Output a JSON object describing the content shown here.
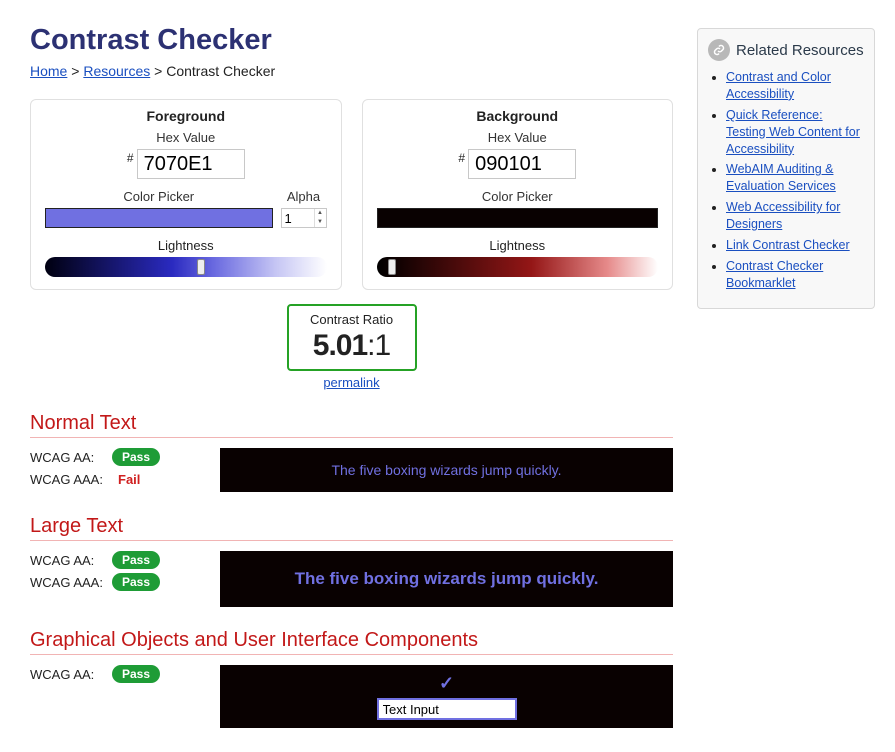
{
  "title": "Contrast Checker",
  "breadcrumbs": {
    "home": "Home",
    "resources": "Resources",
    "current": "Contrast Checker"
  },
  "foreground": {
    "heading": "Foreground",
    "hex_label": "Hex Value",
    "hex_value": "7070E1",
    "picker_label": "Color Picker",
    "alpha_label": "Alpha",
    "alpha_value": "1",
    "lightness_label": "Lightness",
    "swatch_color": "#7070E1"
  },
  "background": {
    "heading": "Background",
    "hex_label": "Hex Value",
    "hex_value": "090101",
    "picker_label": "Color Picker",
    "lightness_label": "Lightness",
    "swatch_color": "#090101"
  },
  "ratio": {
    "label": "Contrast Ratio",
    "value": "5.01",
    "suffix": ":1",
    "permalink": "permalink"
  },
  "normal_text": {
    "heading": "Normal Text",
    "aa_label": "WCAG AA:",
    "aa_result": "Pass",
    "aaa_label": "WCAG AAA:",
    "aaa_result": "Fail",
    "sample": "The five boxing wizards jump quickly."
  },
  "large_text": {
    "heading": "Large Text",
    "aa_label": "WCAG AA:",
    "aa_result": "Pass",
    "aaa_label": "WCAG AAA:",
    "aaa_result": "Pass",
    "sample": "The five boxing wizards jump quickly."
  },
  "gui": {
    "heading": "Graphical Objects and User Interface Components",
    "aa_label": "WCAG AA:",
    "aa_result": "Pass",
    "input_value": "Text Input"
  },
  "sidebar": {
    "heading": "Related Resources",
    "items": [
      "Contrast and Color Accessibility",
      "Quick Reference: Testing Web Content for Accessibility",
      "WebAIM Auditing & Evaluation Services",
      "Web Accessibility for Designers",
      "Link Contrast Checker",
      "Contrast Checker Bookmarklet"
    ]
  }
}
